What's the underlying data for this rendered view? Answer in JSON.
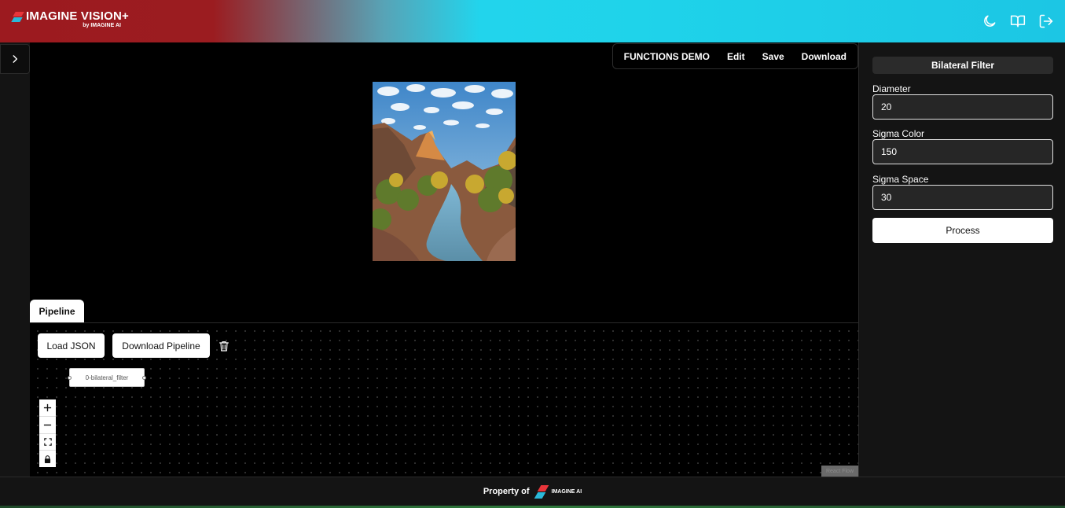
{
  "header": {
    "app_title": "IMAGINE VISION+",
    "app_subtitle": "by IMAGINE AI",
    "icons": [
      "moon-icon",
      "book-icon",
      "logout-icon"
    ]
  },
  "toolbar": {
    "title": "FUNCTIONS DEMO",
    "edit_label": "Edit",
    "save_label": "Save",
    "download_label": "Download"
  },
  "pipeline": {
    "tab_label": "Pipeline",
    "load_json_label": "Load JSON",
    "download_pipeline_label": "Download Pipeline",
    "node_label": "0-bilateral_filter",
    "attribution": "React Flow",
    "controls": [
      "plus-icon",
      "minus-icon",
      "fit-view-icon",
      "lock-icon"
    ]
  },
  "panel": {
    "title": "Bilateral Filter",
    "fields": [
      {
        "label": "Diameter",
        "value": "20"
      },
      {
        "label": "Sigma Color",
        "value": "150"
      },
      {
        "label": "Sigma Space",
        "value": "30"
      }
    ],
    "process_label": "Process"
  },
  "footer": {
    "text": "Property of",
    "logo_text": "IMAGINE AI"
  },
  "colors": {
    "header_red": "#9c1a1f",
    "header_cyan": "#1fd3ea",
    "background": "#141414",
    "canvas": "#000000"
  }
}
